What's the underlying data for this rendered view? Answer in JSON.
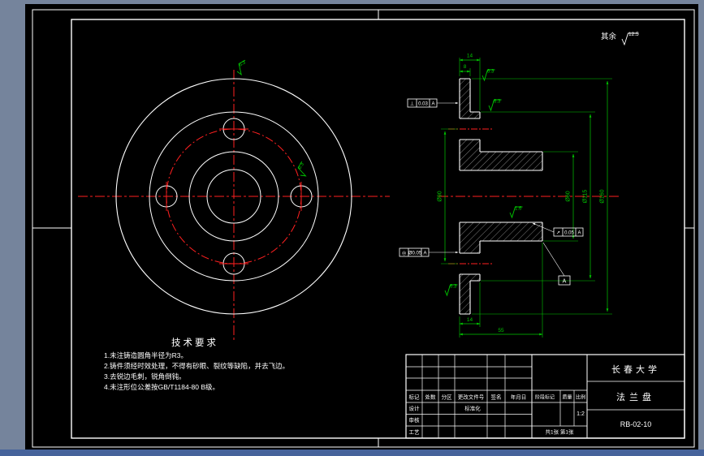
{
  "colors": {
    "window_bg": "#75849C",
    "window_edge": "#46639B",
    "paper": "#000000",
    "line": "#FFFFFF",
    "centerline": "#FF2020",
    "dimension": "#00C800"
  },
  "general_note": {
    "label": "其余",
    "value": "12.5"
  },
  "front_view": {
    "finish_top": "6.3",
    "finish_right": "6.3"
  },
  "section": {
    "dim_outer": "Ø160",
    "dim_boss": "Ø115",
    "dim_hub": "Ø60",
    "dim_bolt_circle": "Ø90",
    "dim_rim_thk": "8",
    "dim_flange_thk": "14",
    "dim_bottom_thk": "14",
    "dim_length": "55",
    "finish_1": "6.3",
    "finish_2": "6.3",
    "finish_3": "1.6",
    "finish_4": "6.3",
    "gdt1": {
      "symbol": "⊥",
      "tolerance": "0.03",
      "datum": "A"
    },
    "gdt2": {
      "symbol": "◎",
      "tolerance": "Ø0.05",
      "datum": "A"
    },
    "gdt3": {
      "symbol": "↗",
      "tolerance": "0.05",
      "datum": "A"
    },
    "datum": "A"
  },
  "tech_requirements": {
    "title": "技术要求",
    "items": [
      "1.未注铸造圆角半径为R3。",
      "2.铸件须经时效处理，不得有砂眼、裂纹等缺陷，并去飞边。",
      "3.去锐边毛刺，锐角倒钝。",
      "4.未注形位公差按GB/T1184-80 B级。"
    ]
  },
  "title_block": {
    "rev_row": [
      "标记",
      "处数",
      "分区",
      "更改文件号",
      "签名",
      "年月日"
    ],
    "design": "设计",
    "standardization": "标准化",
    "check": "审核",
    "process": "工艺",
    "stage": "阶段标记",
    "weight": "质量",
    "scale": "比例",
    "scale_value": "1:2",
    "sheet": "共1张 第1张",
    "university": "长春大学",
    "part_name": "法兰盘",
    "drawing_no": "RB-02-10"
  }
}
